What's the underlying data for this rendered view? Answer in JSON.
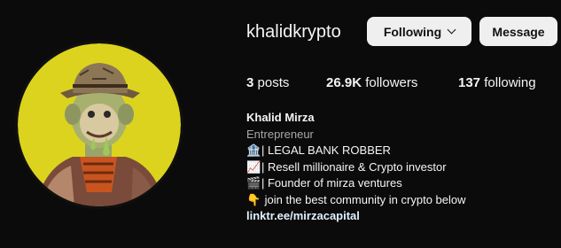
{
  "profile": {
    "username": "khalidkrypto",
    "buttons": {
      "following_label": "Following",
      "message_label": "Message"
    },
    "stats": {
      "posts_count": "3",
      "posts_label": "posts",
      "followers_count": "26.9K",
      "followers_label": "followers",
      "following_count": "137",
      "following_label": "following"
    },
    "bio": {
      "name": "Khalid Mirza",
      "category": "Entrepreneur",
      "lines": [
        {
          "icon": "🏦",
          "text": "| LEGAL BANK ROBBER"
        },
        {
          "icon": "📈",
          "text": "| Resell millionaire & Crypto investor"
        },
        {
          "icon": "🎬",
          "text": "| Founder of mirza ventures"
        },
        {
          "icon": "👇",
          "text": " join the best community in crypto below"
        }
      ],
      "link": "linktr.ee/mirzacapital"
    },
    "avatar": {
      "description_icon": "ape-avatar-image",
      "background_color": "#dcd31e"
    }
  },
  "colors": {
    "page_background": "#0b0b0b",
    "button_background": "#efefef",
    "muted_text": "#a8a8a8",
    "link_text": "#e0f1ff"
  }
}
